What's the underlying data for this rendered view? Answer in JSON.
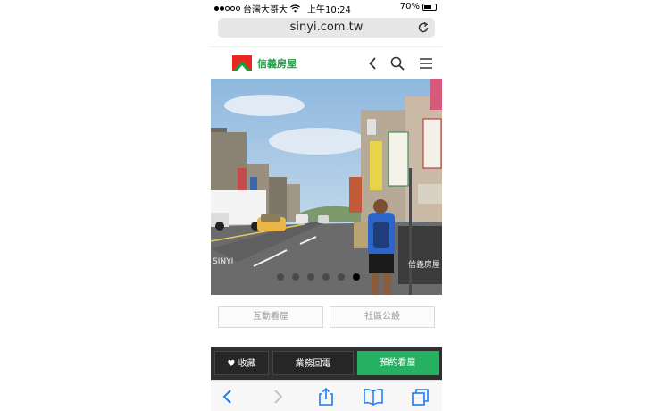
{
  "status": {
    "carrier": "台灣大哥大",
    "time": "上午10:24",
    "battery": "70%",
    "battery_level": 0.7,
    "signal_bars": 2
  },
  "browser": {
    "url": "sinyi.com.tw",
    "icons": [
      "reload-icon",
      "back-icon",
      "forward-icon",
      "share-icon",
      "bookmarks-icon",
      "tabs-icon"
    ]
  },
  "site": {
    "logo_text": "信義房屋",
    "nav_icons": [
      "chevron-left-icon",
      "search-icon",
      "menu-icon"
    ]
  },
  "photo": {
    "watermark_left": "SINYI",
    "watermark_right": "信義房屋",
    "total": 6,
    "active": 6
  },
  "actions": {
    "interactive_viewing": "互動看屋",
    "community": "社區公設"
  },
  "bottom": {
    "favorite": "收藏",
    "callback": "業務回電",
    "book": "預約看屋"
  },
  "colors": {
    "brand_green": "#26b062",
    "brand_red": "#e6281d"
  }
}
